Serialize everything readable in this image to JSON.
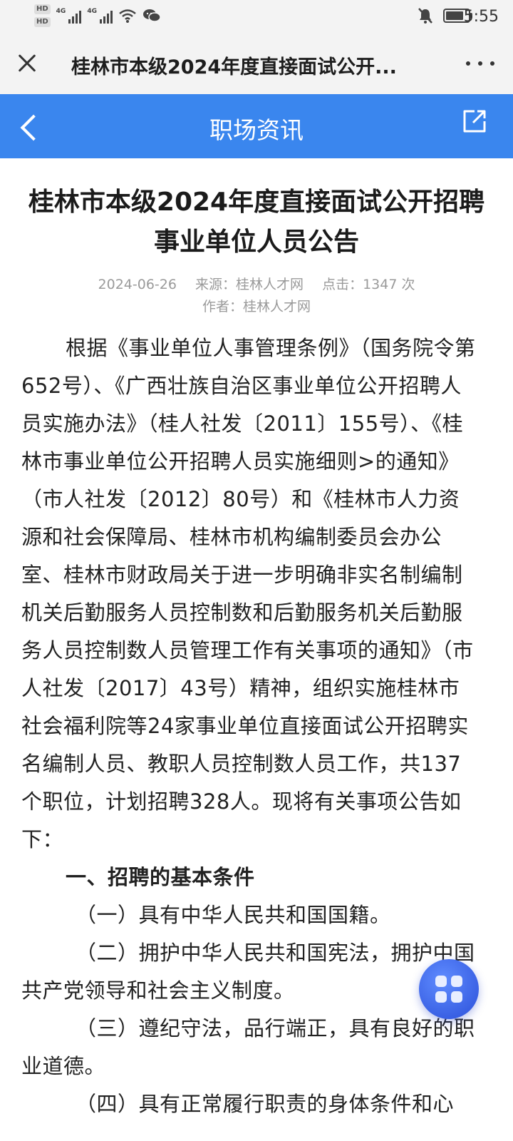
{
  "status_bar": {
    "time": "5:55",
    "hd1": "HD",
    "hd2": "HD",
    "net1": "4G",
    "net2": "4G",
    "icons": [
      "signal-icon",
      "wifi-icon",
      "wechat-icon",
      "mute-bell-icon",
      "battery-icon"
    ]
  },
  "nav": {
    "title": "桂林市本级2024年度直接面试公开...",
    "icons": [
      "close-icon",
      "more-icon"
    ]
  },
  "header": {
    "title": "职场资讯",
    "icons": [
      "back-icon",
      "share-icon"
    ]
  },
  "article": {
    "title": "桂林市本级2024年度直接面试公开招聘事业单位人员公告",
    "date": "2024-06-26",
    "source": "来源：桂林人才网",
    "clicks": "点击：1347 次",
    "author": "作者：桂林人才网",
    "intro": "根据《事业单位人事管理条例》（国务院令第652号）、《广西壮族自治区事业单位公开招聘人员实施办法》（桂人社发〔2011〕155号）、《桂林市事业单位公开招聘人员实施细则>的通知》（市人社发〔2012〕80号）和《桂林市人力资源和社会保障局、桂林市机构编制委员会办公室、桂林市财政局关于进一步明确非实名制编制机关后勤服务人员控制数和后勤服务机关后勤服务人员控制数人员管理工作有关事项的通知》（市人社发〔2017〕43号）精神，组织实施桂林市社会福利院等24家事业单位直接面试公开招聘实名编制人员、教职人员控制数人员工作，共137个职位，计划招聘328人。现将有关事项公告如下：",
    "section1": "一、招聘的基本条件",
    "items": [
      "（一）具有中华人民共和国国籍。",
      "（二）拥护中华人民共和国宪法，拥护中国共产党领导和社会主义制度。",
      "（三）遵纪守法，品行端正，具有良好的职业道德。",
      "（四）具有正常履行职责的身体条件和心"
    ]
  },
  "fab": {
    "icon": "apps-grid-icon"
  }
}
